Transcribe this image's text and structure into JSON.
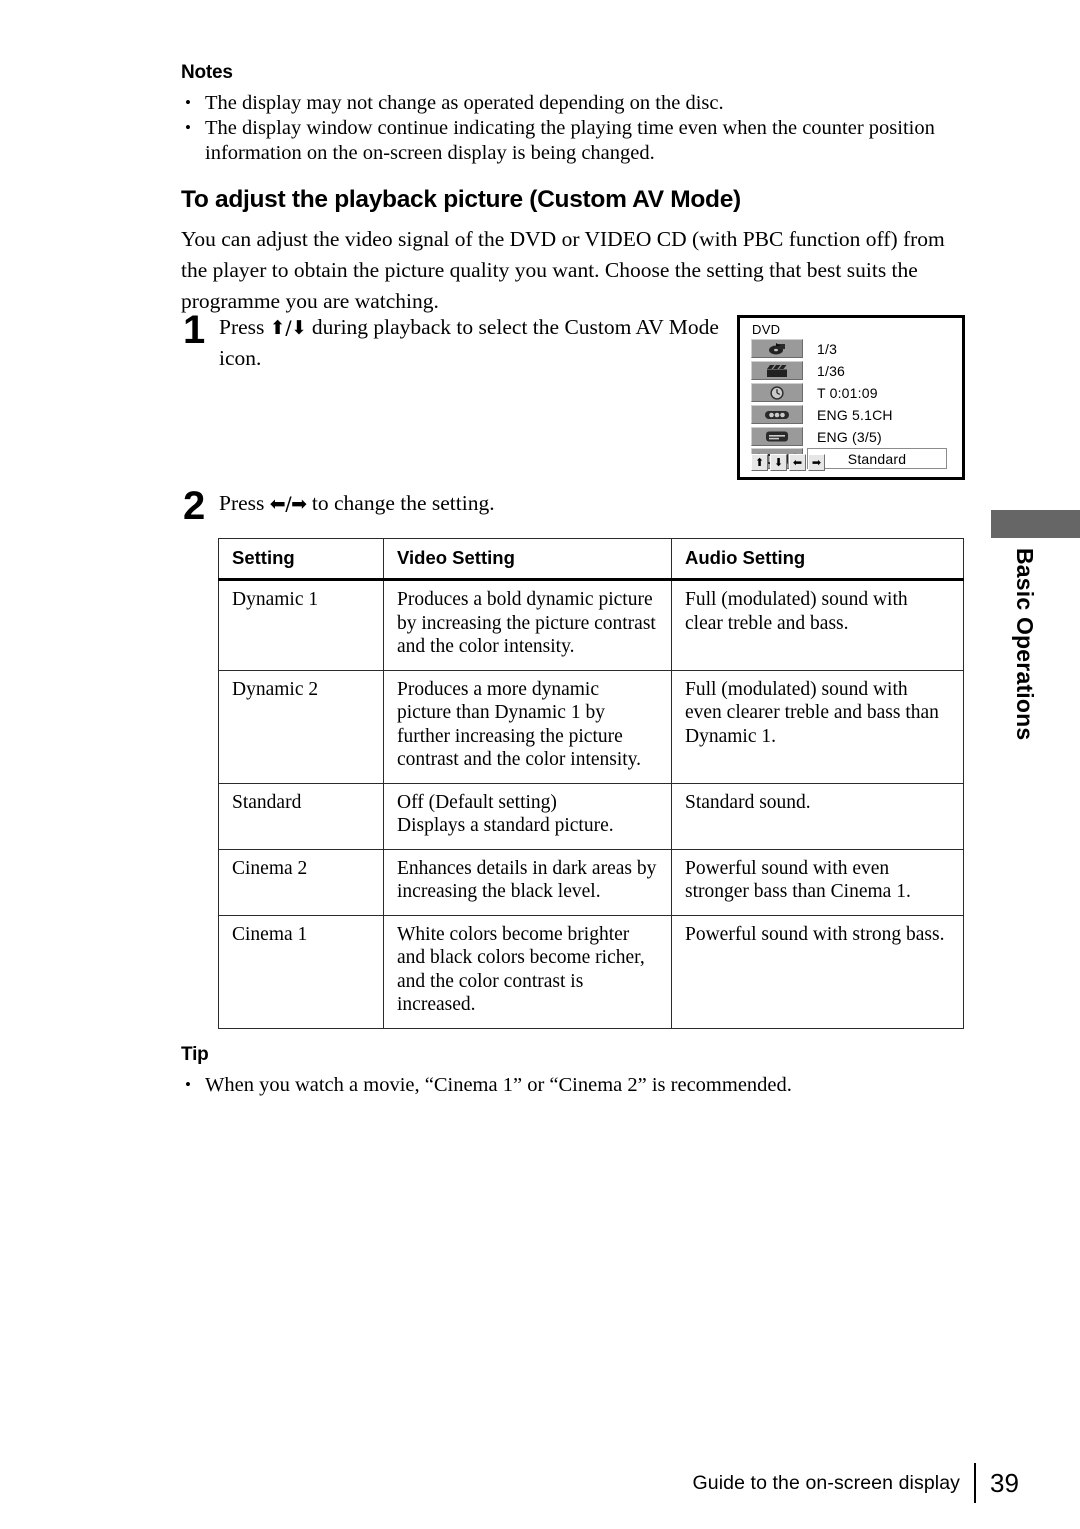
{
  "notes": {
    "heading": "Notes",
    "items": [
      "The display may not change as operated depending on the disc.",
      "The display window continue indicating the playing time even when the counter position information on the on-screen display is being changed."
    ]
  },
  "section": {
    "heading": "To adjust the playback picture (Custom AV Mode)",
    "intro": "You can adjust the video signal of the DVD or VIDEO CD (with PBC function off) from the player to obtain the picture quality you want. Choose the setting that best suits the programme you are watching."
  },
  "steps": [
    {
      "number": "1",
      "text_before": "Press ",
      "arrows": "⬆/⬇",
      "text_after": " during playback to select the Custom AV Mode icon."
    },
    {
      "number": "2",
      "text_before": "Press ",
      "arrows": "⬅/➡",
      "text_after": " to change the setting."
    }
  ],
  "osd": {
    "disc_label": "DVD",
    "rows": [
      {
        "icon": "title-icon",
        "value": "1/3"
      },
      {
        "icon": "chapter-icon",
        "value": "1/36"
      },
      {
        "icon": "time-icon",
        "value": "T 0:01:09"
      },
      {
        "icon": "audio-icon",
        "value": "ENG 5.1CH"
      },
      {
        "icon": "subtitle-icon",
        "value": "ENG  (3/5)"
      }
    ],
    "selected_row": {
      "icon": "custom-av-mode-icon",
      "value": "Standard"
    },
    "arrow_buttons": [
      "⬆",
      "⬇",
      "⬅",
      "➡"
    ]
  },
  "table": {
    "headers": [
      "Setting",
      "Video Setting",
      "Audio Setting"
    ],
    "rows": [
      {
        "setting": "Dynamic 1",
        "video": [
          "Produces a bold dynamic picture",
          "by increasing the picture contrast",
          "and the color intensity."
        ],
        "audio": [
          "Full (modulated) sound with",
          "clear treble and bass."
        ]
      },
      {
        "setting": "Dynamic 2",
        "video": [
          "Produces a more dynamic",
          "picture than Dynamic 1 by",
          "further increasing the picture",
          "contrast and the color intensity."
        ],
        "audio": [
          "Full (modulated) sound with",
          "even clearer treble and bass than",
          "Dynamic 1."
        ]
      },
      {
        "setting": "Standard",
        "video": [
          "Off (Default setting)",
          "Displays a standard picture."
        ],
        "audio": [
          "Standard sound."
        ]
      },
      {
        "setting": "Cinema 2",
        "video": [
          "Enhances details in dark areas by",
          "increasing the black level."
        ],
        "audio": [
          "Powerful sound with even",
          "stronger bass than Cinema 1."
        ]
      },
      {
        "setting": "Cinema 1",
        "video": [
          "White colors become brighter",
          "and black colors become richer,",
          "and the color contrast is",
          "increased."
        ],
        "audio": [
          "Powerful sound with strong bass."
        ]
      }
    ]
  },
  "tip": {
    "heading": "Tip",
    "items": [
      "When you watch a movie, “Cinema 1” or “Cinema 2” is recommended."
    ]
  },
  "side_tab": {
    "label": "Basic Operations",
    "block_color": "#666666"
  },
  "footer": {
    "caption": "Guide to the on-screen display",
    "page_number": "39"
  }
}
